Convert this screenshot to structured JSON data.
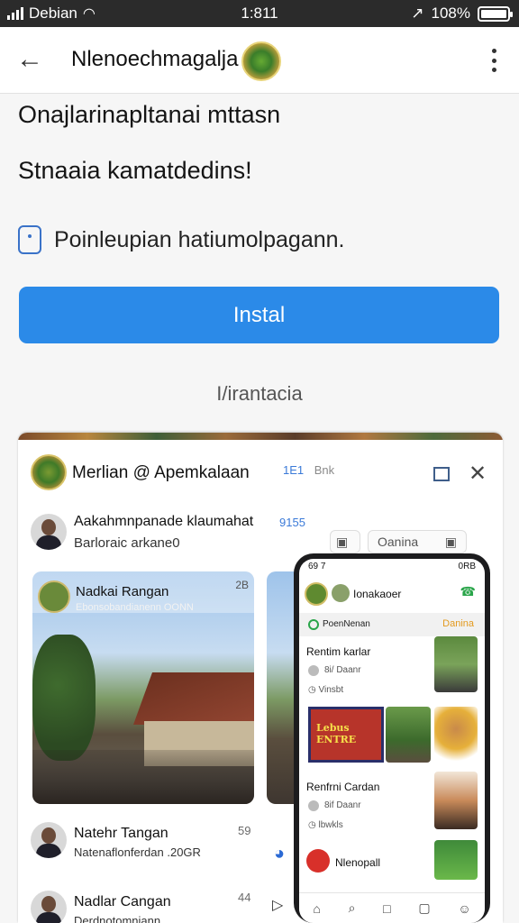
{
  "status_bar": {
    "carrier": "Debian",
    "time": "1:811",
    "battery_percent": "108%",
    "signal_bars": 4
  },
  "header": {
    "title": "Nlenoechmagalja"
  },
  "content": {
    "line1": "Onajlarinapltanai mttasn",
    "line2": "Stnaaia kamatdedins!",
    "info_text": "Poinleupian hatiumolpagann.",
    "install_label": "Instal",
    "sub_link": "I/irantacia"
  },
  "preview": {
    "title": "Merlian @ Apemkalaan",
    "meta_num": "1E1",
    "meta_text": "Bnk",
    "row1": {
      "name": "Aakahmnpanade klaumahat",
      "sub": "Barloraic arkane0",
      "num": "9155",
      "button": "Oanina"
    },
    "photo_card": {
      "title": "Nadkai Rangan",
      "subtitle": "Ebonsobandianenn OONN",
      "num": "2B"
    },
    "row2": {
      "name": "Natehr Tangan",
      "sub": "Natenaflonferdan .20GR",
      "num": "59"
    },
    "row3": {
      "name": "Nadlar Cangan",
      "sub": "Derdnotomniann",
      "num": "44"
    }
  },
  "phone": {
    "status_time": "69 7",
    "status_right": "0RB",
    "head_title": "Ionakaoer",
    "bar_text": "PoenNenan",
    "bar_button": "Danina",
    "item1": {
      "name": "Rentim karlar",
      "sub": "8i/ Daanr",
      "extra": "Vinsbt"
    },
    "sign_text": "Lebus ENTRE",
    "item2": {
      "name": "Renfrni Cardan",
      "sub": "8if Daanr",
      "extra": "lbwkls"
    },
    "item3": {
      "name": "Nlenopall"
    }
  },
  "colors": {
    "accent": "#2b8ae8",
    "status_bar": "#2b2b2b",
    "green": "#2aa54a",
    "orange": "#e39a1e"
  }
}
